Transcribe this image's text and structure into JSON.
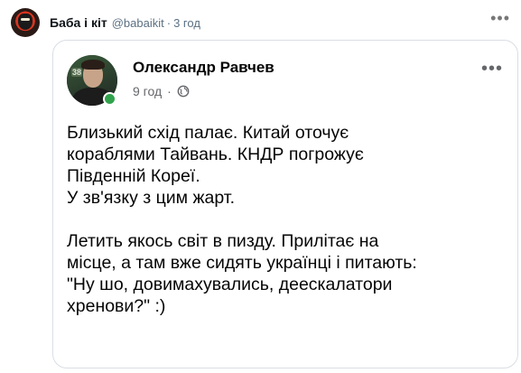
{
  "outer": {
    "name": "Баба і кіт",
    "handle": "@babaikit",
    "separator": "·",
    "time": "3 год",
    "more": "•••"
  },
  "card": {
    "author": "Олександр Равчев",
    "time": "9 год",
    "separator": "·",
    "more": "•••",
    "avatar_badge": "38",
    "paragraph1": "Близький схід палає. Китай оточує\nкораблями Тайвань. КНДР погрожує\nПівденній Кореї.\nУ зв'язку з цим жарт.",
    "paragraph2": "Летить якось світ в пизду. Прилітає на\nмісце, а там вже сидять українці і питають:\n\"Ну шо, довимахувались, деескалатори\nхренови?\" :)"
  },
  "colors": {
    "online": "#31a24c",
    "secondary_text": "#65676b",
    "border": "#d9dee3"
  },
  "icons": [
    "avatar",
    "globe-icon",
    "more-icon",
    "online-status-icon"
  ]
}
